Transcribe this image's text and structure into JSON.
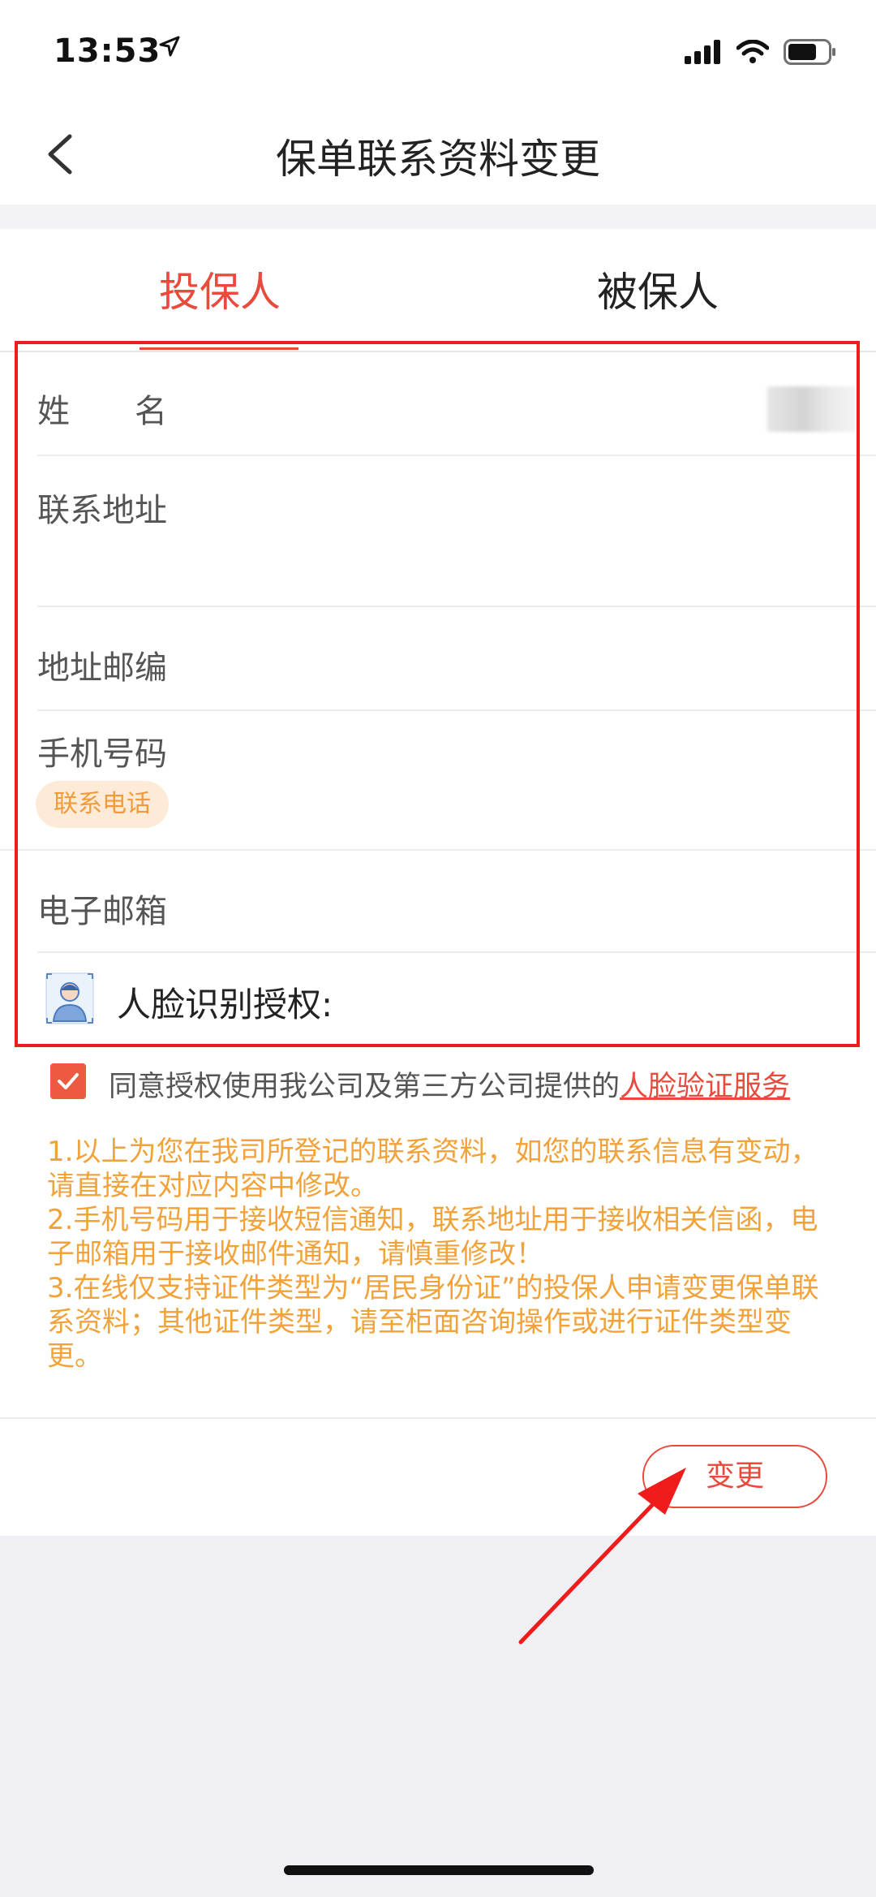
{
  "status_bar": {
    "time": "13:53",
    "icons": [
      "location-arrow-icon",
      "cellular-signal-icon",
      "wifi-icon",
      "battery-icon"
    ]
  },
  "nav": {
    "title": "保单联系资料变更",
    "back_icon": "chevron-left-icon"
  },
  "tabs": [
    {
      "label": "投保人",
      "active": true
    },
    {
      "label": "被保人",
      "active": false
    }
  ],
  "form": {
    "name_label": "姓　　名",
    "address_label": "联系地址",
    "postcode_label": "地址邮编",
    "phone_label": "手机号码",
    "phone_tag": "联系电话",
    "email_label": "电子邮箱",
    "face_label": "人脸识别授权:"
  },
  "consent": {
    "checked": true,
    "text": "同意授权使用我公司及第三方公司提供的",
    "link": "人脸验证服务"
  },
  "notes": [
    "1.以上为您在我司所登记的联系资料，如您的联系信息有变动，请直接在对应内容中修改。",
    "2.手机号码用于接收短信通知，联系地址用于接收相关信函，电子邮箱用于接收邮件通知，请慎重修改！",
    "3.在线仅支持证件类型为“居民身份证”的投保人申请变更保单联系资料；其他证件类型，请至柜面咨询操作或进行证件类型变更。"
  ],
  "actions": {
    "change_label": "变更"
  },
  "colors": {
    "accent": "#e84a3c",
    "note_orange": "#f1a23a",
    "annotation_red": "#ee1c1c"
  }
}
